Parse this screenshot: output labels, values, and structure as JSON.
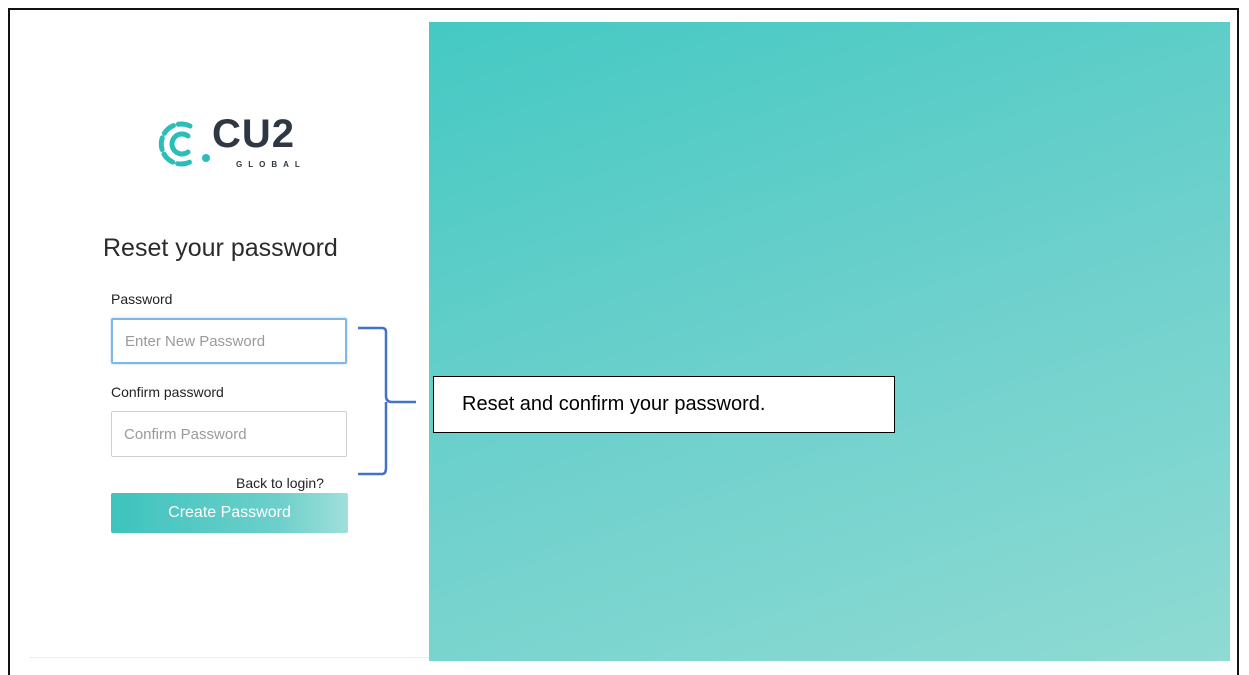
{
  "logo": {
    "name": "CU2",
    "subtitle": "GLOBAL",
    "mark_color": "#2bbdb8"
  },
  "form": {
    "title": "Reset your password",
    "password": {
      "label": "Password",
      "placeholder": "Enter New Password",
      "value": ""
    },
    "confirm": {
      "label": "Confirm password",
      "placeholder": "Confirm Password",
      "value": ""
    },
    "back_link": "Back to login?",
    "submit_label": "Create Password"
  },
  "annotation": {
    "text": "Reset and confirm your password.",
    "brace_color": "#4472c4"
  },
  "colors": {
    "accent": "#45c9c3",
    "accent_light": "#8fdbd3"
  }
}
